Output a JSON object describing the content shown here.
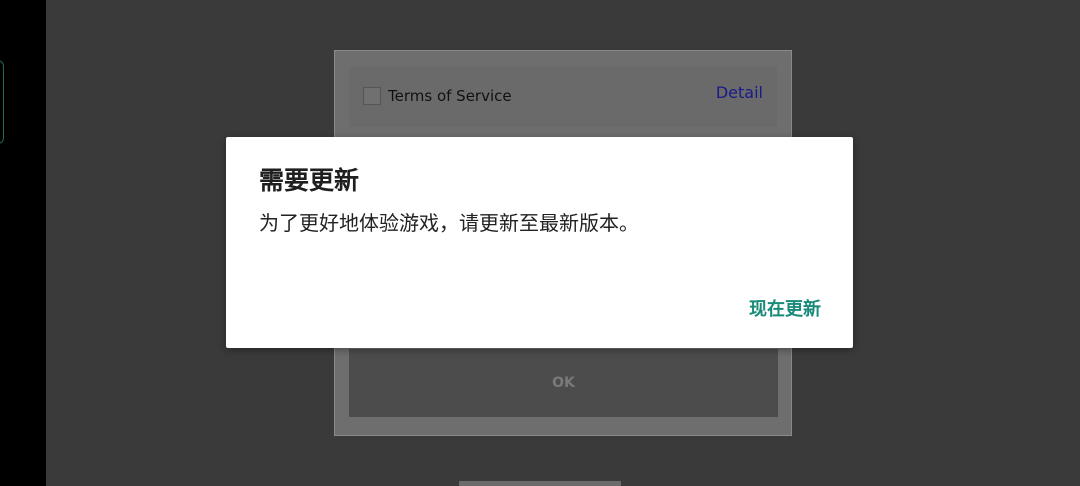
{
  "background_panel": {
    "terms_label": "Terms of Service",
    "detail_link": "Detail",
    "ok_label": "OK"
  },
  "dialog": {
    "title": "需要更新",
    "message": "为了更好地体验游戏，请更新至最新版本。",
    "action_label": "现在更新"
  },
  "colors": {
    "accent": "#1a8a7a",
    "backdrop": "#3a3a3a",
    "dialog_background": "#ffffff"
  }
}
